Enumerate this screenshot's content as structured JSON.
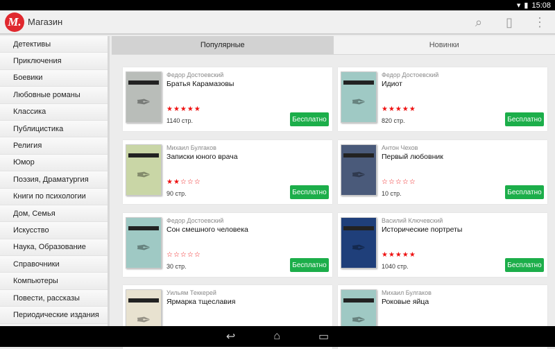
{
  "status": {
    "time": "15:08"
  },
  "appbar": {
    "logo": "М.",
    "title": "Магазин",
    "icons": [
      "search-icon",
      "library-icon",
      "overflow-menu-icon"
    ]
  },
  "sidebar": {
    "items": [
      "Детективы",
      "Приключения",
      "Боевики",
      "Любовные романы",
      "Классика",
      "Публицистика",
      "Религия",
      "Юмор",
      "Поэзия, Драматургия",
      "Книги по психологии",
      "Дом, Семья",
      "Искусство",
      "Наука, Образование",
      "Справочники",
      "Компьютеры",
      "Повести, рассказы",
      "Периодические издания"
    ]
  },
  "tabs": [
    {
      "label": "Популярные",
      "active": true
    },
    {
      "label": "Новинки",
      "active": false
    }
  ],
  "books": [
    {
      "author": "Федор Достоевский",
      "title": "Братья Карамазовы",
      "rating": 5,
      "pages": "1140 стр.",
      "button": "Бесплатно",
      "cover": "#b9bdb9"
    },
    {
      "author": "Федор Достоевский",
      "title": "Идиот",
      "rating": 5,
      "pages": "820 стр.",
      "button": "Бесплатно",
      "cover": "#9fc9c4"
    },
    {
      "author": "Михаил Булгаков",
      "title": "Записки юного врача",
      "rating": 2,
      "pages": "90 стр.",
      "button": "Бесплатно",
      "cover": "#c9d6a6"
    },
    {
      "author": "Антон Чехов",
      "title": "Первый любовник",
      "rating": 0,
      "pages": "10 стр.",
      "button": "Бесплатно",
      "cover": "#4a5a7a"
    },
    {
      "author": "Федор Достоевский",
      "title": "Сон смешного человека",
      "rating": 0,
      "pages": "30 стр.",
      "button": "Бесплатно",
      "cover": "#9fc9c4"
    },
    {
      "author": "Василий Ключевский",
      "title": "Исторические портреты",
      "rating": 5,
      "pages": "1040 стр.",
      "button": "Бесплатно",
      "cover": "#1f3f7a"
    },
    {
      "author": "Уильям Теккерей",
      "title": "Ярмарка тщеславия",
      "cover": "#e8e2d0"
    },
    {
      "author": "Михаил Булгаков",
      "title": "Роковые яйца",
      "cover": "#9fc9c4"
    }
  ]
}
